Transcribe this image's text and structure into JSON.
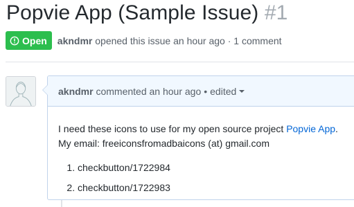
{
  "issue": {
    "title": "Popvie App (Sample Issue)",
    "number": "#1",
    "state": "Open",
    "author": "akndmr",
    "opened_text": "opened this issue an hour ago · 1 comment"
  },
  "comment": {
    "author": "akndmr",
    "action_text": "commented an hour ago",
    "separator": "•",
    "edited_label": "edited",
    "body_line1_text": "I need these icons to use for my open source project ",
    "body_link_text": "Popvie App",
    "body_line1_end": ".",
    "body_line2": "My email: freeiconsfromadbaicons (at) gmail.com",
    "list_items": [
      "checkbutton/1722984",
      "checkbutton/1722983"
    ]
  },
  "colors": {
    "open_badge": "#2cbe4e",
    "link": "#0366d6",
    "header_bg": "#f1f8ff"
  },
  "icons": {
    "state": "issue-opened-icon",
    "avatar": "default-avatar-icon",
    "caret": "caret-down-icon"
  }
}
